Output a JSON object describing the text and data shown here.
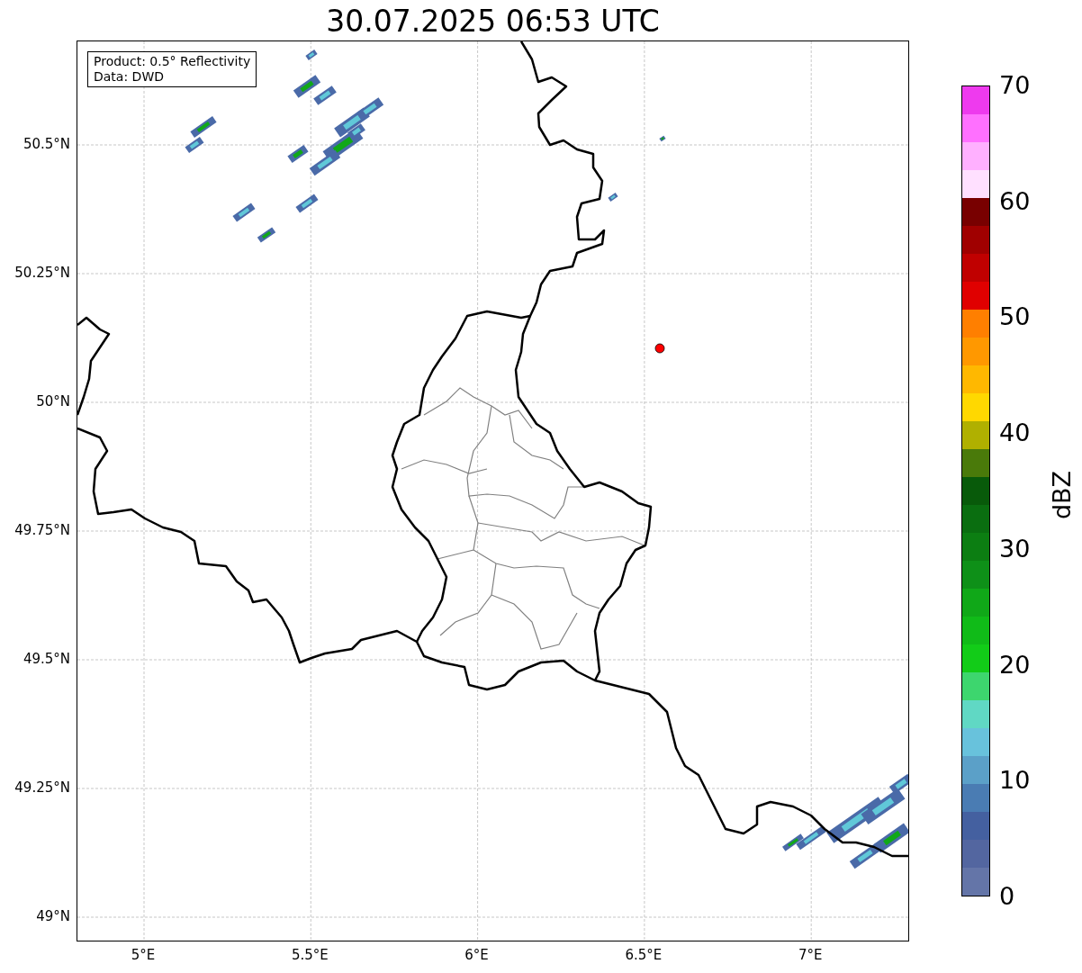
{
  "title": "30.07.2025 06:53 UTC",
  "annotation": [
    "Product: 0.5° Reflectivity",
    "Data: DWD"
  ],
  "y_ticks": [
    "50.5°N",
    "50.25°N",
    "50°N",
    "49.75°N",
    "49.5°N",
    "49.25°N",
    "49°N"
  ],
  "x_ticks": [
    "5°E",
    "5.5°E",
    "6°E",
    "6.5°E",
    "7°E"
  ],
  "colorbar": {
    "label": "dBZ",
    "ticks": [
      "70",
      "60",
      "50",
      "40",
      "30",
      "20",
      "10",
      "0"
    ],
    "bands": [
      {
        "color": "#ee3aee"
      },
      {
        "color": "#ff70ff"
      },
      {
        "color": "#ffb0ff"
      },
      {
        "color": "#ffe0ff"
      },
      {
        "color": "#780000"
      },
      {
        "color": "#a00000"
      },
      {
        "color": "#c00000"
      },
      {
        "color": "#e00000"
      },
      {
        "color": "#ff7f00"
      },
      {
        "color": "#ff9800"
      },
      {
        "color": "#ffb800"
      },
      {
        "color": "#ffd800"
      },
      {
        "color": "#b0b000"
      },
      {
        "color": "#4a7a0a"
      },
      {
        "color": "#085a0a"
      },
      {
        "color": "#0a6e10"
      },
      {
        "color": "#0c7e12"
      },
      {
        "color": "#0e9018"
      },
      {
        "color": "#10a818"
      },
      {
        "color": "#10bb18"
      },
      {
        "color": "#12cc18"
      },
      {
        "color": "#3dd66e"
      },
      {
        "color": "#60d8c4"
      },
      {
        "color": "#68c2dc"
      },
      {
        "color": "#5ba0c8"
      },
      {
        "color": "#4a7cb3"
      },
      {
        "color": "#4460a0"
      },
      {
        "color": "#5366a0"
      },
      {
        "color": "#6475a8"
      }
    ]
  }
}
